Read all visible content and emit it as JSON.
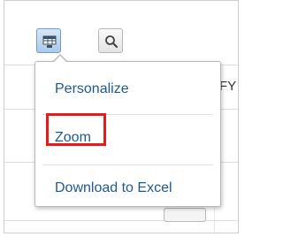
{
  "toolbar": {
    "table_button_icon": "table-settings-icon",
    "search_button_icon": "magnifier-icon"
  },
  "background": {
    "header_fragment": "FY -"
  },
  "menu": {
    "items": [
      {
        "label": "Personalize"
      },
      {
        "label": "Zoom"
      },
      {
        "label": "Download to Excel"
      }
    ]
  },
  "colors": {
    "menu_text": "#1f5a8c",
    "highlight": "#e41c1c",
    "active_button": "#a9c9e8"
  }
}
